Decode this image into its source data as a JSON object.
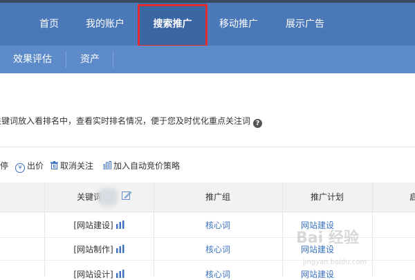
{
  "top_nav": {
    "tabs": [
      {
        "label": "首页",
        "active": false
      },
      {
        "label": "我的账户",
        "active": false
      },
      {
        "label": "搜索推广",
        "active": true
      },
      {
        "label": "移动推广",
        "active": false
      },
      {
        "label": "展示广告",
        "active": false
      }
    ],
    "background": "#4a78b8",
    "highlight_color": "#e52b2b"
  },
  "sub_nav": {
    "items": [
      "效果评估",
      "资产"
    ]
  },
  "info": {
    "text": "关键词放入看排名中，查看实时排名情况，便于您及时优化重点关注词",
    "help_icon": "question-circle-icon"
  },
  "toolbar": {
    "pause_label": "停",
    "bid_label": "出价",
    "unfollow_label": "取消关注",
    "auto_bid_label": "加入自动竞价策略"
  },
  "table": {
    "headers": [
      "关键词",
      "推广组",
      "推广计划",
      "启"
    ],
    "rows": [
      {
        "keyword": "[网站建设]",
        "group": "核心词",
        "plan": "网站建设"
      },
      {
        "keyword": "[网站制作]",
        "group": "核心词",
        "plan": "网站建设"
      },
      {
        "keyword": "[网站设计]",
        "group": "核心词",
        "plan": "网站建设"
      }
    ]
  },
  "watermark": {
    "text": "Bai 经验",
    "sub": "jingyan.baidu.com"
  }
}
